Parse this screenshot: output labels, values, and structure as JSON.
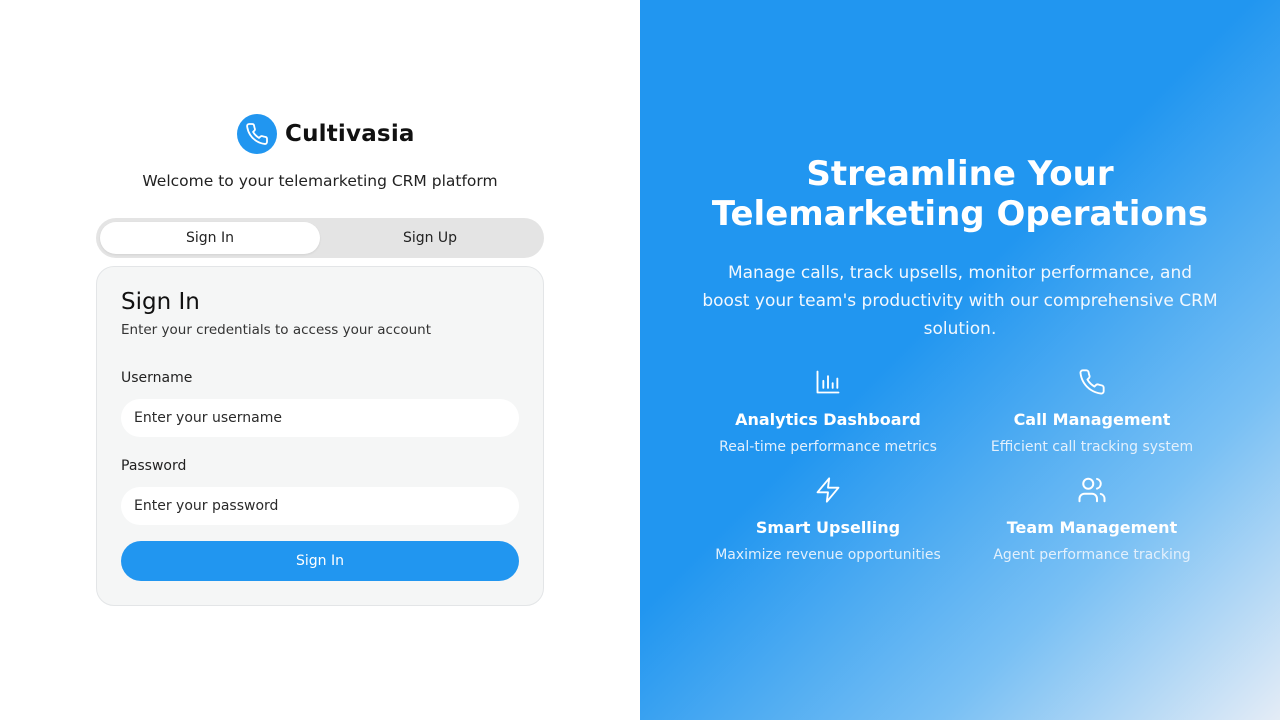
{
  "brand": {
    "name": "Cultivasia",
    "icon": "phone-icon",
    "color": "#2196f0"
  },
  "welcome": "Welcome to your telemarketing CRM platform",
  "tabs": [
    {
      "label": "Sign In",
      "active": true
    },
    {
      "label": "Sign Up",
      "active": false
    }
  ],
  "form": {
    "title": "Sign In",
    "subtitle": "Enter your credentials to access your account",
    "username": {
      "label": "Username",
      "placeholder": "Enter your username",
      "value": ""
    },
    "password": {
      "label": "Password",
      "placeholder": "Enter your password",
      "value": ""
    },
    "submit_label": "Sign In"
  },
  "hero": {
    "title_lines": [
      "Streamline Your",
      "Telemarketing Operations"
    ],
    "subtitle": "Manage calls, track upsells, monitor performance, and boost your team's productivity with our comprehensive CRM solution.",
    "features": [
      {
        "icon": "bar-chart-icon",
        "title": "Analytics Dashboard",
        "desc": "Real-time performance metrics"
      },
      {
        "icon": "phone-icon",
        "title": "Call Management",
        "desc": "Efficient call tracking system"
      },
      {
        "icon": "lightning-icon",
        "title": "Smart Upselling",
        "desc": "Maximize revenue opportunities"
      },
      {
        "icon": "users-icon",
        "title": "Team Management",
        "desc": "Agent performance tracking"
      }
    ]
  },
  "colors": {
    "accent": "#2196f0",
    "card_bg": "#f5f6f6",
    "tab_track": "#e4e4e4"
  }
}
